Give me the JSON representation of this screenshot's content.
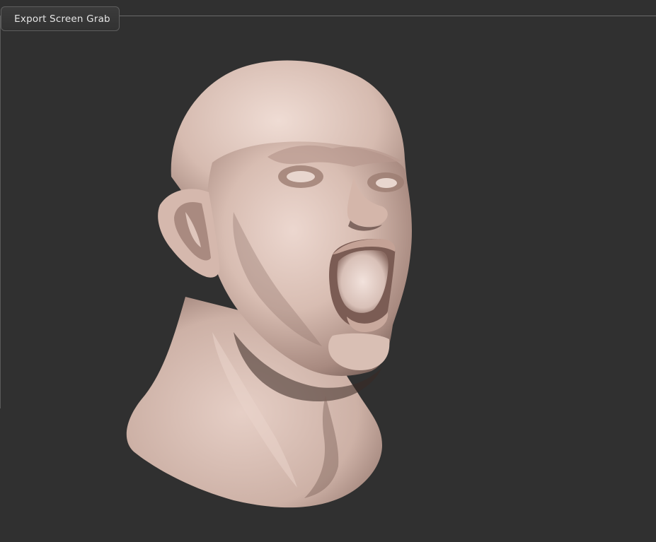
{
  "toolbar": {
    "export_label": "Export Screen Grab"
  },
  "viewport": {
    "content": "3d-head-sculpt-model",
    "background_color": "#303030",
    "material_color": "#d9bfb5"
  }
}
